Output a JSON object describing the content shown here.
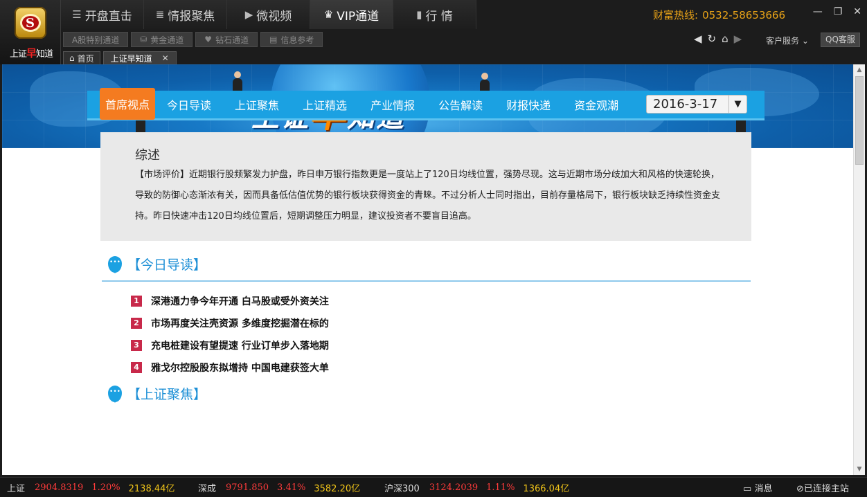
{
  "logo": {
    "text_pre": "上证",
    "text_mid": "早",
    "text_post": "知道"
  },
  "top_tabs": [
    {
      "icon": "list-icon",
      "label": "开盘直击",
      "glyph": "☰"
    },
    {
      "icon": "news-icon",
      "label": "情报聚焦",
      "glyph": "≡"
    },
    {
      "icon": "video-icon",
      "label": "微视频",
      "glyph": "▶"
    },
    {
      "icon": "crown-icon",
      "label": "VIP通道",
      "glyph": "♛"
    },
    {
      "icon": "bar-chart-icon",
      "label": "行 情",
      "glyph": "▮"
    }
  ],
  "hotline": {
    "label": "财富热线:",
    "number": "0532-58653666"
  },
  "sub_tabs": [
    "A股特别通道",
    "黄金通道",
    "钻石通道",
    "信息参考"
  ],
  "service": {
    "label": "客户服务",
    "qq": "QQ客服"
  },
  "doc_tabs": {
    "home": "首页",
    "current": "上证早知道"
  },
  "banner": {
    "title_pre": "上证",
    "title_mid": "早",
    "title_post": "知道"
  },
  "nav": {
    "items": [
      "首席视点",
      "今日导读",
      "上证聚焦",
      "上证精选",
      "产业情报",
      "公告解读",
      "财报快递",
      "资金观潮"
    ],
    "date": "2016-3-17"
  },
  "summary": {
    "title": "综述",
    "body": "【市场评价】近期银行股频繁发力护盘，昨日申万银行指数更是一度站上了120日均线位置，强势尽现。这与近期市场分歧加大和风格的快速轮换，导致的防御心态渐浓有关，因而具备低估值优势的银行板块获得资金的青睐。不过分析人士同时指出，目前存量格局下，银行板块缺乏持续性资金支持。昨日快速冲击120日均线位置后，短期调整压力明显，建议投资者不要盲目追高。"
  },
  "sections": {
    "today": {
      "title": "【今日导读】",
      "items": [
        {
          "num": "1",
          "text": "深港通力争今年开通 白马股或受外资关注"
        },
        {
          "num": "2",
          "text": "市场再度关注壳资源 多维度挖掘潜在标的"
        },
        {
          "num": "3",
          "text": "充电桩建设有望提速 行业订单步入落地期"
        },
        {
          "num": "4",
          "text": "雅戈尔控股股东拟增持 中国电建获签大单"
        }
      ]
    },
    "focus": {
      "title": "【上证聚焦】"
    }
  },
  "status": {
    "sh": {
      "name": "上证",
      "price": "2904.8319",
      "pct": "1.20%",
      "amt": "2138.44亿"
    },
    "sz": {
      "name": "深成",
      "price": "9791.850",
      "pct": "3.41%",
      "amt": "3582.20亿"
    },
    "hs": {
      "name": "沪深300",
      "price": "3124.2039",
      "pct": "1.11%",
      "amt": "1366.04亿"
    },
    "msg": "消息",
    "conn": "已连接主站"
  },
  "colors": {
    "accent": "#1ba1e2",
    "active_nav": "#f47b20",
    "up": "#ff3b3b",
    "amount": "#f0c419",
    "hotline": "#e9a317"
  }
}
